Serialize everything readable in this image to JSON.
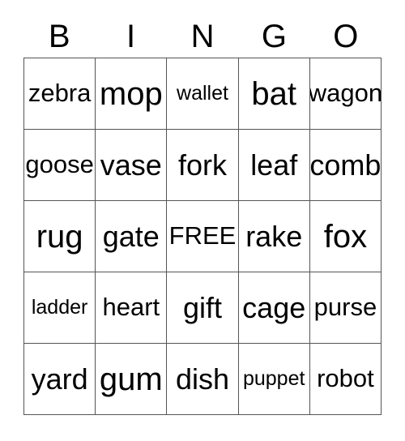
{
  "card": {
    "columns": [
      "B",
      "I",
      "N",
      "G",
      "O"
    ],
    "free_space_label": "FREE",
    "rows": [
      [
        {
          "label": "zebra"
        },
        {
          "label": "mop"
        },
        {
          "label": "wallet"
        },
        {
          "label": "bat"
        },
        {
          "label": "wagon"
        }
      ],
      [
        {
          "label": "goose"
        },
        {
          "label": "vase"
        },
        {
          "label": "fork"
        },
        {
          "label": "leaf"
        },
        {
          "label": "comb"
        }
      ],
      [
        {
          "label": "rug"
        },
        {
          "label": "gate"
        },
        {
          "label": "FREE"
        },
        {
          "label": "rake"
        },
        {
          "label": "fox"
        }
      ],
      [
        {
          "label": "ladder"
        },
        {
          "label": "heart"
        },
        {
          "label": "gift"
        },
        {
          "label": "cage"
        },
        {
          "label": "purse"
        }
      ],
      [
        {
          "label": "yard"
        },
        {
          "label": "gum"
        },
        {
          "label": "dish"
        },
        {
          "label": "puppet"
        },
        {
          "label": "robot"
        }
      ]
    ]
  },
  "style": {
    "background_color": "#ffffff",
    "text_color": "#000000",
    "grid_line_color": "#555555"
  }
}
